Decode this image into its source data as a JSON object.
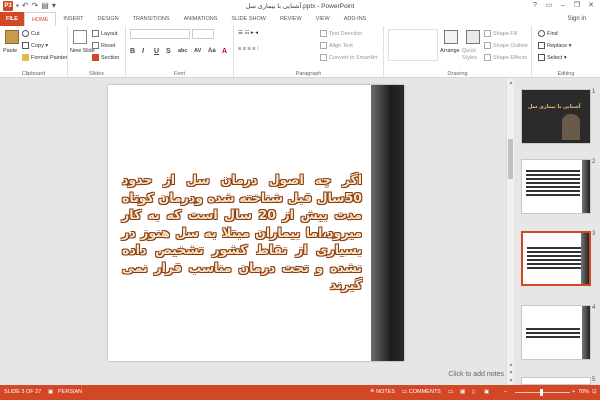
{
  "window": {
    "title": "آشنایی با بیماری سل.pptx - PowerPoint",
    "app_icon": "P3",
    "controls": [
      "?",
      "▭",
      "–",
      "❐",
      "✕"
    ]
  },
  "tabs": [
    "FILE",
    "HOME",
    "INSERT",
    "DESIGN",
    "TRANSITIONS",
    "ANIMATIONS",
    "SLIDE SHOW",
    "REVIEW",
    "VIEW",
    "ADD-INS"
  ],
  "active_tab": "HOME",
  "sign_in": "Sign in",
  "ribbon": {
    "clipboard": {
      "label": "Clipboard",
      "paste": "Paste",
      "cut": "Cut",
      "copy": "Copy",
      "format_painter": "Format Painter"
    },
    "slides": {
      "label": "Slides",
      "new_slide": "New Slide",
      "layout": "Layout",
      "reset": "Reset",
      "section": "Section"
    },
    "font": {
      "label": "Font",
      "bold": "B",
      "italic": "I",
      "underline": "U",
      "strike": "S",
      "shadow": "abc",
      "spacing": "AV",
      "case": "Aa",
      "color": "A"
    },
    "paragraph": {
      "label": "Paragraph",
      "text_direction": "Text Direction",
      "align_text": "Align Text",
      "smartart": "Convert to SmartArt"
    },
    "drawing": {
      "label": "Drawing",
      "arrange": "Arrange",
      "quick_styles": "Quick Styles",
      "shape_fill": "Shape Fill",
      "shape_outline": "Shape Outline",
      "shape_effects": "Shape Effects"
    },
    "editing": {
      "label": "Editing",
      "find": "Find",
      "replace": "Replace",
      "select": "Select"
    }
  },
  "slide": {
    "text": "اگر چه اصول درمان سل از حدود 50سال قبل شناخته شده ودرمان کوتاه مدت بیش از 20 سال است که به کار میرود،اما بیماران مبتلا به سل هنوز در بسیاری از نقاط کشور تشخیص داده نشده و تحت درمان مناسب قرار نمی گیرند"
  },
  "notes_placeholder": "Click to add notes",
  "thumbnails": [
    {
      "number": "1",
      "title": "آشنایی با بیماری سل"
    },
    {
      "number": "2"
    },
    {
      "number": "3",
      "selected": true
    },
    {
      "number": "4"
    },
    {
      "number": "5"
    }
  ],
  "status": {
    "slide_count": "SLIDE 3 OF 27",
    "language": "PERSIAN",
    "notes": "NOTES",
    "comments": "COMMENTS",
    "zoom": "70%"
  },
  "colors": {
    "accent": "#d24726",
    "text_fill": "#f7e6c6",
    "text_outline": "#8a3a10"
  }
}
